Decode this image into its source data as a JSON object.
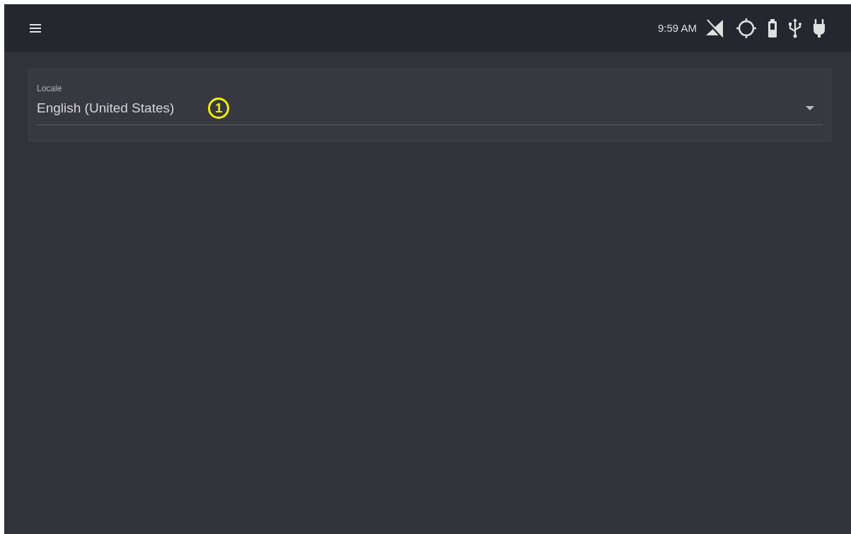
{
  "status_bar": {
    "time": "9:59 AM"
  },
  "locale_field": {
    "label": "Locale",
    "value": "English (United States)"
  },
  "callout": {
    "number": "1"
  }
}
